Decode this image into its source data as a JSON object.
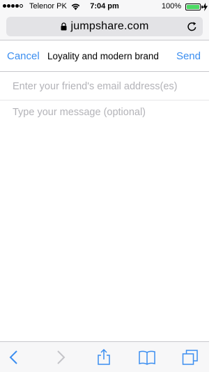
{
  "status_bar": {
    "carrier": "Telenor PK",
    "time": "7:04 pm",
    "battery_percent": "100%",
    "battery_level": 1.0,
    "signal_bars_filled": 4,
    "signal_bars_total": 5
  },
  "browser": {
    "url": "jumpshare.com"
  },
  "compose": {
    "cancel_label": "Cancel",
    "title": "Loyality and modern brand",
    "send_label": "Send",
    "email_placeholder": "Enter your friend's email address(es)",
    "email_value": "",
    "message_placeholder": "Type your message (optional)",
    "message_value": ""
  },
  "toolbar": {
    "icons": [
      "back-icon",
      "forward-icon",
      "share-icon",
      "bookmarks-icon",
      "tabs-icon"
    ]
  },
  "colors": {
    "accent": "#3b8ef0",
    "battery": "#4cd964",
    "toolbar_icon_active": "#3b8ef0",
    "toolbar_icon_disabled": "#c4c4c8"
  }
}
